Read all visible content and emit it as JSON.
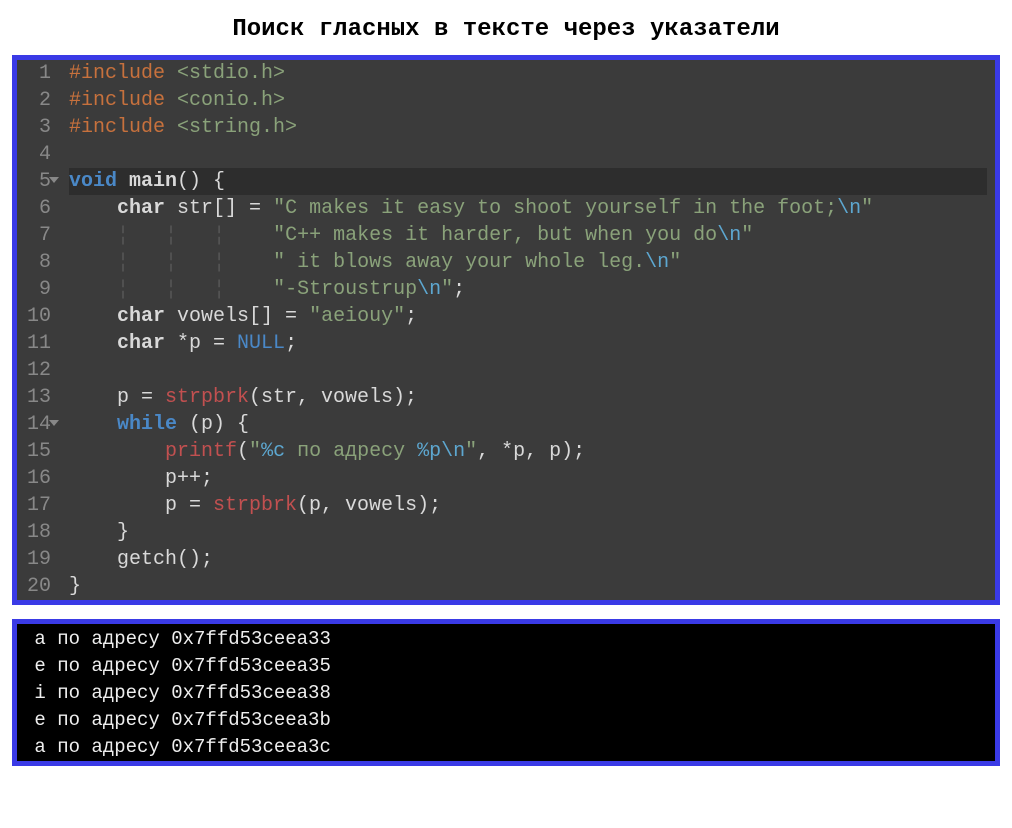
{
  "title": "Поиск гласных в тексте через указатели",
  "code": {
    "line_numbers": [
      "1",
      "2",
      "3",
      "4",
      "5",
      "6",
      "7",
      "8",
      "9",
      "10",
      "11",
      "12",
      "13",
      "14",
      "15",
      "16",
      "17",
      "18",
      "19",
      "20"
    ],
    "fold_lines": [
      5,
      14
    ],
    "active_lines": [
      5
    ],
    "lines": [
      [
        {
          "cls": "tk-pre",
          "t": "#include"
        },
        {
          "cls": "tk-punc",
          "t": " "
        },
        {
          "cls": "tk-inc",
          "t": "<stdio.h>"
        }
      ],
      [
        {
          "cls": "tk-pre",
          "t": "#include"
        },
        {
          "cls": "tk-punc",
          "t": " "
        },
        {
          "cls": "tk-inc",
          "t": "<conio.h>"
        }
      ],
      [
        {
          "cls": "tk-pre",
          "t": "#include"
        },
        {
          "cls": "tk-punc",
          "t": " "
        },
        {
          "cls": "tk-inc",
          "t": "<string.h>"
        }
      ],
      [],
      [
        {
          "cls": "tk-kw",
          "t": "void"
        },
        {
          "cls": "tk-punc",
          "t": " "
        },
        {
          "cls": "tk-base",
          "t": "main"
        },
        {
          "cls": "tk-punc",
          "t": "() {"
        }
      ],
      [
        {
          "cls": "tk-punc",
          "t": "    "
        },
        {
          "cls": "tk-type",
          "t": "char"
        },
        {
          "cls": "tk-punc",
          "t": " str[] = "
        },
        {
          "cls": "tk-str",
          "t": "\"C makes it easy to shoot yourself in the foot;"
        },
        {
          "cls": "tk-esc",
          "t": "\\n"
        },
        {
          "cls": "tk-str",
          "t": "\""
        }
      ],
      [
        {
          "cls": "tk-punc",
          "t": "    "
        },
        {
          "cls": "tk-guide",
          "t": "¦"
        },
        {
          "cls": "tk-punc",
          "t": "   "
        },
        {
          "cls": "tk-guide",
          "t": "¦"
        },
        {
          "cls": "tk-punc",
          "t": "   "
        },
        {
          "cls": "tk-guide",
          "t": "¦"
        },
        {
          "cls": "tk-punc",
          "t": "    "
        },
        {
          "cls": "tk-str",
          "t": "\"C++ makes it harder, but when you do"
        },
        {
          "cls": "tk-esc",
          "t": "\\n"
        },
        {
          "cls": "tk-str",
          "t": "\""
        }
      ],
      [
        {
          "cls": "tk-punc",
          "t": "    "
        },
        {
          "cls": "tk-guide",
          "t": "¦"
        },
        {
          "cls": "tk-punc",
          "t": "   "
        },
        {
          "cls": "tk-guide",
          "t": "¦"
        },
        {
          "cls": "tk-punc",
          "t": "   "
        },
        {
          "cls": "tk-guide",
          "t": "¦"
        },
        {
          "cls": "tk-punc",
          "t": "    "
        },
        {
          "cls": "tk-str",
          "t": "\" it blows away your whole leg."
        },
        {
          "cls": "tk-esc",
          "t": "\\n"
        },
        {
          "cls": "tk-str",
          "t": "\""
        }
      ],
      [
        {
          "cls": "tk-punc",
          "t": "    "
        },
        {
          "cls": "tk-guide",
          "t": "¦"
        },
        {
          "cls": "tk-punc",
          "t": "   "
        },
        {
          "cls": "tk-guide",
          "t": "¦"
        },
        {
          "cls": "tk-punc",
          "t": "   "
        },
        {
          "cls": "tk-guide",
          "t": "¦"
        },
        {
          "cls": "tk-punc",
          "t": "    "
        },
        {
          "cls": "tk-str",
          "t": "\"-Stroustrup"
        },
        {
          "cls": "tk-esc",
          "t": "\\n"
        },
        {
          "cls": "tk-str",
          "t": "\""
        },
        {
          "cls": "tk-punc",
          "t": ";"
        }
      ],
      [
        {
          "cls": "tk-punc",
          "t": "    "
        },
        {
          "cls": "tk-type",
          "t": "char"
        },
        {
          "cls": "tk-punc",
          "t": " vowels[] = "
        },
        {
          "cls": "tk-str",
          "t": "\"aeiouy\""
        },
        {
          "cls": "tk-punc",
          "t": ";"
        }
      ],
      [
        {
          "cls": "tk-punc",
          "t": "    "
        },
        {
          "cls": "tk-type",
          "t": "char"
        },
        {
          "cls": "tk-punc",
          "t": " *p = "
        },
        {
          "cls": "tk-const",
          "t": "NULL"
        },
        {
          "cls": "tk-punc",
          "t": ";"
        }
      ],
      [],
      [
        {
          "cls": "tk-punc",
          "t": "    p = "
        },
        {
          "cls": "tk-fn",
          "t": "strpbrk"
        },
        {
          "cls": "tk-punc",
          "t": "(str, vowels);"
        }
      ],
      [
        {
          "cls": "tk-punc",
          "t": "    "
        },
        {
          "cls": "tk-kw",
          "t": "while"
        },
        {
          "cls": "tk-punc",
          "t": " (p) {"
        }
      ],
      [
        {
          "cls": "tk-punc",
          "t": "        "
        },
        {
          "cls": "tk-fn",
          "t": "printf"
        },
        {
          "cls": "tk-punc",
          "t": "("
        },
        {
          "cls": "tk-str",
          "t": "\""
        },
        {
          "cls": "tk-esc",
          "t": "%c"
        },
        {
          "cls": "tk-str",
          "t": " по адресу "
        },
        {
          "cls": "tk-esc",
          "t": "%p"
        },
        {
          "cls": "tk-esc",
          "t": "\\n"
        },
        {
          "cls": "tk-str",
          "t": "\""
        },
        {
          "cls": "tk-punc",
          "t": ", *p, p);"
        }
      ],
      [
        {
          "cls": "tk-punc",
          "t": "        p++;"
        }
      ],
      [
        {
          "cls": "tk-punc",
          "t": "        p = "
        },
        {
          "cls": "tk-fn",
          "t": "strpbrk"
        },
        {
          "cls": "tk-punc",
          "t": "(p, vowels);"
        }
      ],
      [
        {
          "cls": "tk-punc",
          "t": "    }"
        }
      ],
      [
        {
          "cls": "tk-punc",
          "t": "    getch();"
        }
      ],
      [
        {
          "cls": "tk-punc",
          "t": "}"
        }
      ]
    ]
  },
  "console": {
    "lines": [
      " a по адресу 0x7ffd53ceea33",
      " e по адресу 0x7ffd53ceea35",
      " i по адресу 0x7ffd53ceea38",
      " e по адресу 0x7ffd53ceea3b",
      " a по адресу 0x7ffd53ceea3c"
    ]
  }
}
